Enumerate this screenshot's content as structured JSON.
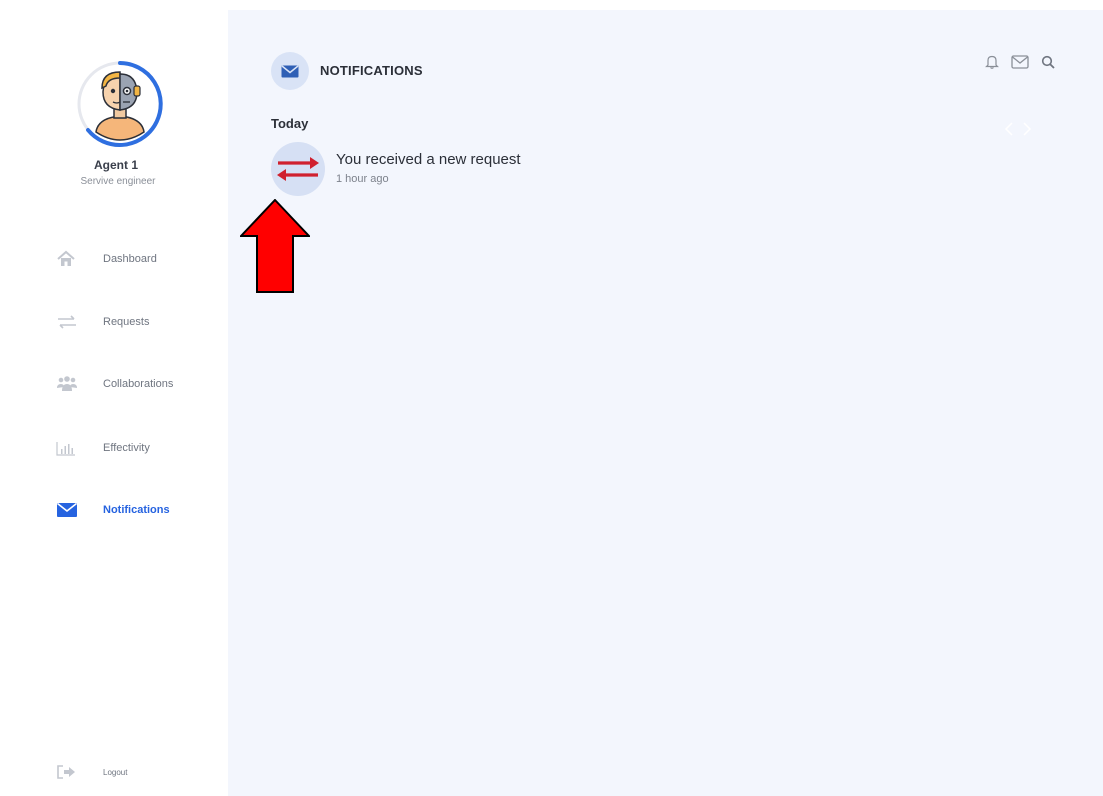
{
  "profile": {
    "name": "Agent 1",
    "role": "Servive engineer",
    "avatar_icon": "robot-human-avatar-icon",
    "ring_color": "#2f6fe0"
  },
  "sidebar": {
    "items": [
      {
        "label": "Dashboard",
        "icon": "home-icon"
      },
      {
        "label": "Requests",
        "icon": "swap-arrows-icon"
      },
      {
        "label": "Collaborations",
        "icon": "group-icon"
      },
      {
        "label": "Effectivity",
        "icon": "bar-chart-icon"
      },
      {
        "label": "Notifications",
        "icon": "envelope-icon",
        "active": true
      }
    ],
    "logout": {
      "label": "Logout",
      "icon": "sign-out-icon"
    }
  },
  "header": {
    "title": "NOTIFICATIONS",
    "icon": "envelope-icon",
    "actions": [
      "bell-icon",
      "mail-icon",
      "search-icon"
    ]
  },
  "notifications": {
    "groups": [
      {
        "heading": "Today",
        "items": [
          {
            "text": "You received a new request",
            "time": "1 hour ago",
            "icon": "swap-arrows-icon"
          }
        ]
      }
    ]
  },
  "colors": {
    "accent": "#2663e0",
    "main_bg": "#f3f6fd",
    "notif_arrow": "#d0202e",
    "annotation": "#ff0000"
  }
}
